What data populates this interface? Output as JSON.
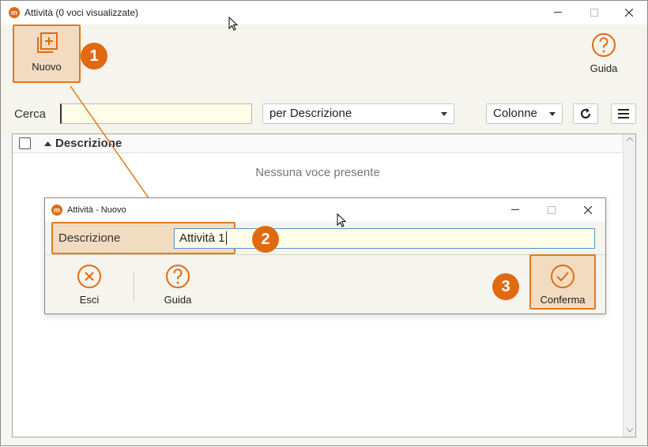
{
  "window": {
    "title": "Attività (0 voci visualizzate)",
    "logo_letter": "m"
  },
  "toolbar": {
    "new_label": "Nuovo",
    "help_label": "Guida"
  },
  "search": {
    "label": "Cerca",
    "value": "",
    "mode": "per Descrizione",
    "columns": "Colonne"
  },
  "grid": {
    "column_header": "Descrizione",
    "empty_text": "Nessuna voce presente"
  },
  "dialog": {
    "title": "Attività - Nuovo",
    "field_label": "Descrizione",
    "field_value": "Attività 1",
    "exit_label": "Esci",
    "help_label": "Guida",
    "confirm_label": "Conferma"
  },
  "steps": [
    "1",
    "2",
    "3"
  ],
  "colors": {
    "accent": "#e06a12",
    "highlight": "#f0be8c",
    "input_bg": "#fdfde8"
  }
}
